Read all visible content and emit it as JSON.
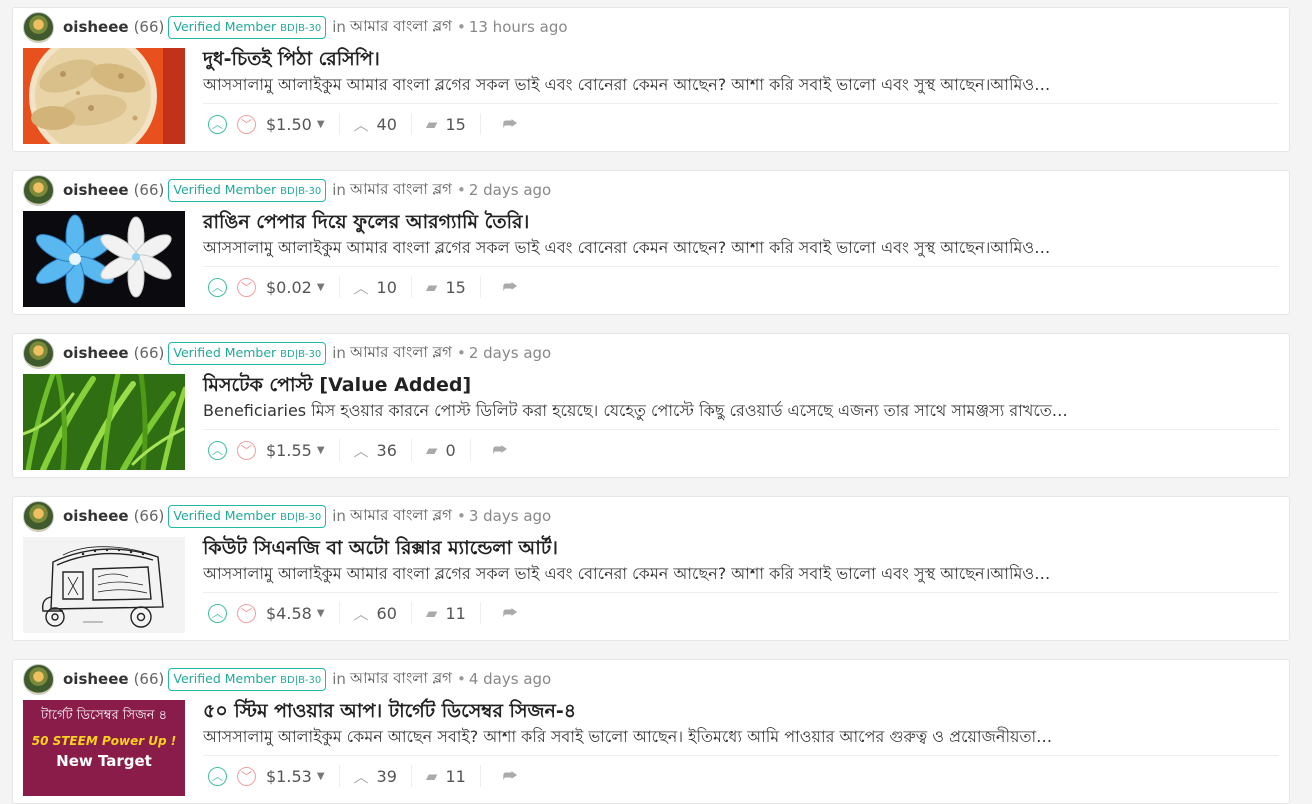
{
  "posts": [
    {
      "author": "oisheee",
      "reputation": "(66)",
      "badge_text": "Verified Member",
      "badge_tag": "BD|B-30",
      "in_label": "in",
      "community": "আমার বাংলা ব্লগ",
      "time": "13 hours ago",
      "title": "দুধ-চিতই পিঠা রেসিপি।",
      "excerpt": "আসসালামু আলাইকুম আমার বাংলা ব্লগের সকল ভাই এবং বোনেরা কেমন আছেন? আশা করি সবাই ভালো এবং সুস্থ আছেন।আমিও…",
      "payout": "$1.50",
      "votes": "40",
      "comments": "15",
      "thumb_desc": "chitoi-pitha"
    },
    {
      "author": "oisheee",
      "reputation": "(66)",
      "badge_text": "Verified Member",
      "badge_tag": "BD|B-30",
      "in_label": "in",
      "community": "আমার বাংলা ব্লগ",
      "time": "2 days ago",
      "title": "রাঙিন পেপার দিয়ে ফুলের আরগ্যামি তৈরি।",
      "excerpt": "আসসালামু আলাইকুম আমার বাংলা ব্লগের সকল ভাই এবং বোনেরা কেমন আছেন? আশা করি সবাই ভালো এবং সুস্থ আছেন।আমিও…",
      "payout": "$0.02",
      "votes": "10",
      "comments": "15",
      "thumb_desc": "paper-flowers"
    },
    {
      "author": "oisheee",
      "reputation": "(66)",
      "badge_text": "Verified Member",
      "badge_tag": "BD|B-30",
      "in_label": "in",
      "community": "আমার বাংলা ব্লগ",
      "time": "2 days ago",
      "title": "মিসটেক পোস্ট [Value Added]",
      "excerpt": "Beneficiaries মিস হওয়ার কারনে পোস্ট ডিলিট করা হয়েছে। যেহেতু পোস্টে কিছু রেওয়ার্ড এসেছে এজন্য তার সাথে সামঞ্জস্য রাখতে…",
      "payout": "$1.55",
      "votes": "36",
      "comments": "0",
      "thumb_desc": "green-grass"
    },
    {
      "author": "oisheee",
      "reputation": "(66)",
      "badge_text": "Verified Member",
      "badge_tag": "BD|B-30",
      "in_label": "in",
      "community": "আমার বাংলা ব্লগ",
      "time": "3 days ago",
      "title": "কিউট সিএনজি বা অটো রিক্সার ম্যান্ডেলা আর্ট।",
      "excerpt": "আসসালামু আলাইকুম আমার বাংলা ব্লগের সকল ভাই এবং বোনেরা কেমন আছেন? আশা করি সবাই ভালো এবং সুস্থ আছেন।আমিও…",
      "payout": "$4.58",
      "votes": "60",
      "comments": "11",
      "thumb_desc": "rickshaw-mandala"
    },
    {
      "author": "oisheee",
      "reputation": "(66)",
      "badge_text": "Verified Member",
      "badge_tag": "BD|B-30",
      "in_label": "in",
      "community": "আমার বাংলা ব্লগ",
      "time": "4 days ago",
      "title": "৫০ স্টিম পাওয়ার আপ। টার্গেট ডিসেম্বর সিজন-৪",
      "excerpt": "আসসালামু আলাইকুম কেমন আছেন সবাই? আশা করি সবাই ভালো আছেন। ইতিমধ্যে আমি পাওয়ার আপের গুরুত্ব ও প্রয়োজনীয়তা…",
      "payout": "$1.53",
      "votes": "39",
      "comments": "11",
      "thumb_desc": "power-up-banner",
      "thumb_text": {
        "line1": "টার্গেট ডিসেম্বর সিজন ৪",
        "line2": "50 STEEM Power Up !",
        "line3": "New Target"
      }
    }
  ],
  "icons": {
    "upvote": "chevron-up-icon",
    "downvote": "chevron-down-icon",
    "votes": "caret-up-icon",
    "comments": "comment-icon",
    "share": "reblog-icon"
  },
  "colors": {
    "badge": "#22b8a8",
    "upvote": "#3fbf9f",
    "downvote": "#f0a0a0"
  }
}
